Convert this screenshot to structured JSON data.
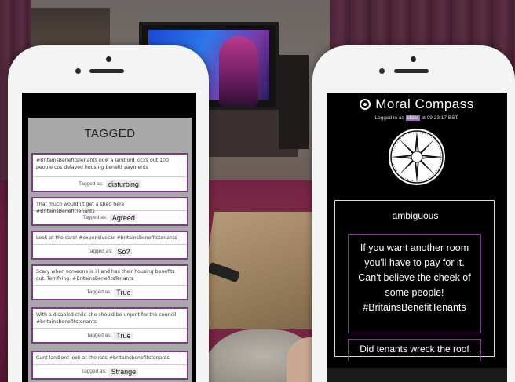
{
  "left_phone": {
    "title": "TAGGED",
    "tag_label": "Tagged as:",
    "items": [
      {
        "text": "#BritainsBenefitsTenants now a landlord kicks out 100 people cos delayed housing benefit payments",
        "tag": "disturbing"
      },
      {
        "text": "That much wouldn't get a shed here #BritainsBenefitTenants",
        "tag": "Agreed"
      },
      {
        "text": "Look at the cars! #expensivecar #britainsbenefitstenants",
        "tag": "So?"
      },
      {
        "text": "Scary when someone is ill and has their housing benefits cut. Terrifying. #BritainsBenefitsTenants",
        "tag": "True"
      },
      {
        "text": "With a disabled child she should be urgent for the council #britainsbenefitstenants",
        "tag": "True"
      },
      {
        "text": "Cunt landlord look at the rats #britainsbenefitstenants",
        "tag": "Strange"
      }
    ]
  },
  "right_phone": {
    "app_title": "Moral Compass",
    "login_prefix": "Logged in as",
    "username": "state",
    "login_suffix": "at 09:23:17 BST.",
    "category": "ambiguous",
    "tweet": "If you want another room you'll have to pay for it. Can't believe the cheek of some people! #BritainsBenefitTenants",
    "next_tweet": "Did tenants wreck the roof"
  },
  "colors": {
    "accent_purple": "#7d3a88",
    "username_highlight": "#9b6fb5",
    "panel_gray": "#a8a8a8"
  }
}
